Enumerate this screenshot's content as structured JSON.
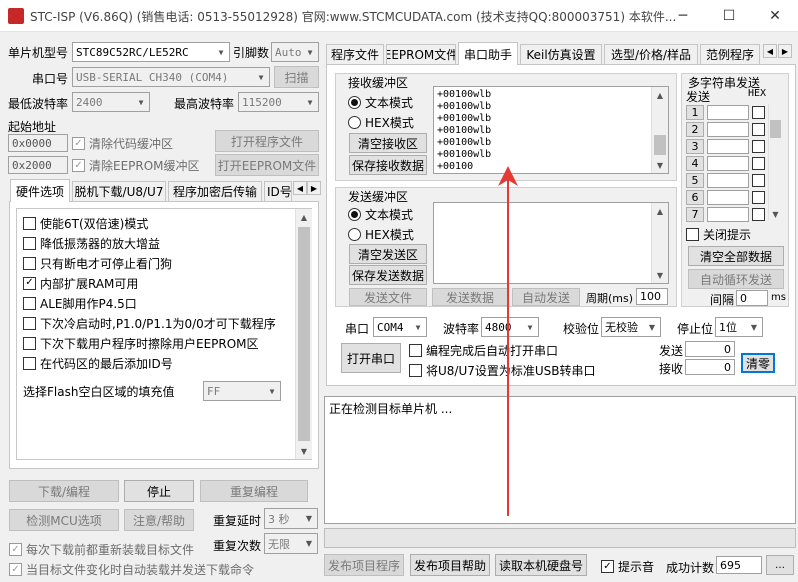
{
  "window": {
    "title": "STC-ISP (V6.86Q) (销售电话: 0513-55012928) 官网:www.STCMCUDATA.com  (技术支持QQ:800003751) 本软件...",
    "minimize": "─",
    "maximize": "☐",
    "close": "✕"
  },
  "left": {
    "mcu_type_label": "单片机型号",
    "mcu_type_value": "STC89C52RC/LE52RC",
    "pin_count_label": "引脚数",
    "pin_count_value": "Auto",
    "port_label": "串口号",
    "port_value": "USB-SERIAL CH340 (COM4)",
    "scan_button": "扫描",
    "min_baud_label": "最低波特率",
    "min_baud_value": "2400",
    "max_baud_label": "最高波特率",
    "max_baud_value": "115200",
    "start_addr_label": "起始地址",
    "code_addr": "0x0000",
    "clear_code_label": "清除代码缓冲区",
    "open_program_button": "打开程序文件",
    "eeprom_addr": "0x2000",
    "clear_eeprom_label": "清除EEPROM缓冲区",
    "open_eeprom_button": "打开EEPROM文件",
    "tabs": [
      "硬件选项",
      "脱机下载/U8/U7",
      "程序加密后传输",
      "ID号"
    ],
    "options": [
      {
        "label": "使能6T(双倍速)模式",
        "checked": false
      },
      {
        "label": "降低振荡器的放大增益",
        "checked": false
      },
      {
        "label": "只有断电才可停止看门狗",
        "checked": false
      },
      {
        "label": "内部扩展RAM可用",
        "checked": true
      },
      {
        "label": "ALE脚用作P4.5口",
        "checked": false
      },
      {
        "label": "下次冷启动时,P1.0/P1.1为0/0才可下载程序",
        "checked": false
      },
      {
        "label": "下次下载用户程序时擦除用户EEPROM区",
        "checked": false
      },
      {
        "label": "在代码区的最后添加ID号",
        "checked": false
      }
    ],
    "fill_label": "选择Flash空白区域的填充值",
    "fill_value": "FF",
    "download_button": "下载/编程",
    "stop_button": "停止",
    "reprogram_button": "重复编程",
    "detect_button": "检测MCU选项",
    "help_button": "注意/帮助",
    "repeat_delay_label": "重复延时",
    "repeat_delay_value": "3 秒",
    "repeat_count_label": "重复次数",
    "repeat_count_value": "无限",
    "reload_before_label": "每次下载前都重新装载目标文件",
    "auto_reload_label": "当目标文件变化时自动装载并发送下载命令"
  },
  "right": {
    "tabs": [
      "程序文件",
      "EEPROM文件",
      "串口助手",
      "Keil仿真设置",
      "选型/价格/样品",
      "范例程序"
    ],
    "receive": {
      "title": "接收缓冲区",
      "text_mode": "文本模式",
      "hex_mode": "HEX模式",
      "clear_button": "清空接收区",
      "save_button": "保存接收数据",
      "lines": [
        "+00100wlb",
        "+00100wlb",
        "+00100wlb",
        "+00100wlb",
        "+00100wlb",
        "+00100wlb",
        "+00100"
      ]
    },
    "send": {
      "title": "发送缓冲区",
      "text_mode": "文本模式",
      "hex_mode": "HEX模式",
      "clear_button": "清空发送区",
      "save_button": "保存发送数据",
      "send_file_button": "发送文件",
      "send_data_button": "发送数据",
      "auto_send_button": "自动发送",
      "period_label": "周期(ms)",
      "period_value": "100"
    },
    "multi": {
      "title": "多字符串发送",
      "send_header": "发送",
      "hex_header": "HEX",
      "rows": [
        "1",
        "2",
        "3",
        "4",
        "5",
        "6",
        "7"
      ],
      "close_hint_label": "关闭提示",
      "clear_all_button": "清空全部数据",
      "auto_loop_button": "自动循环发送",
      "interval_label": "间隔",
      "interval_value": "0",
      "interval_unit": "ms"
    },
    "serial": {
      "port_label": "串口",
      "port_value": "COM4",
      "baud_label": "波特率",
      "baud_value": "4800",
      "parity_label": "校验位",
      "parity_value": "无校验",
      "stop_label": "停止位",
      "stop_value": "1位",
      "open_button": "打开串口",
      "auto_open_label": "编程完成后自动打开串口",
      "usb_label": "将U8/U7设置为标准USB转串口",
      "send_label": "发送",
      "send_value": "0",
      "recv_label": "接收",
      "recv_value": "0",
      "clear_count_button": "清零"
    },
    "log_text": "正在检测目标单片机 ...",
    "publish_program_button": "发布项目程序",
    "publish_help_button": "发布项目帮助",
    "read_disk_button": "读取本机硬盘号",
    "sound_label": "提示音",
    "success_label": "成功计数",
    "success_value": "695"
  },
  "colors": {
    "annotation_arrow": "#e53935",
    "title_icon": "#c62828",
    "clear_button_border": "#0078d7"
  }
}
